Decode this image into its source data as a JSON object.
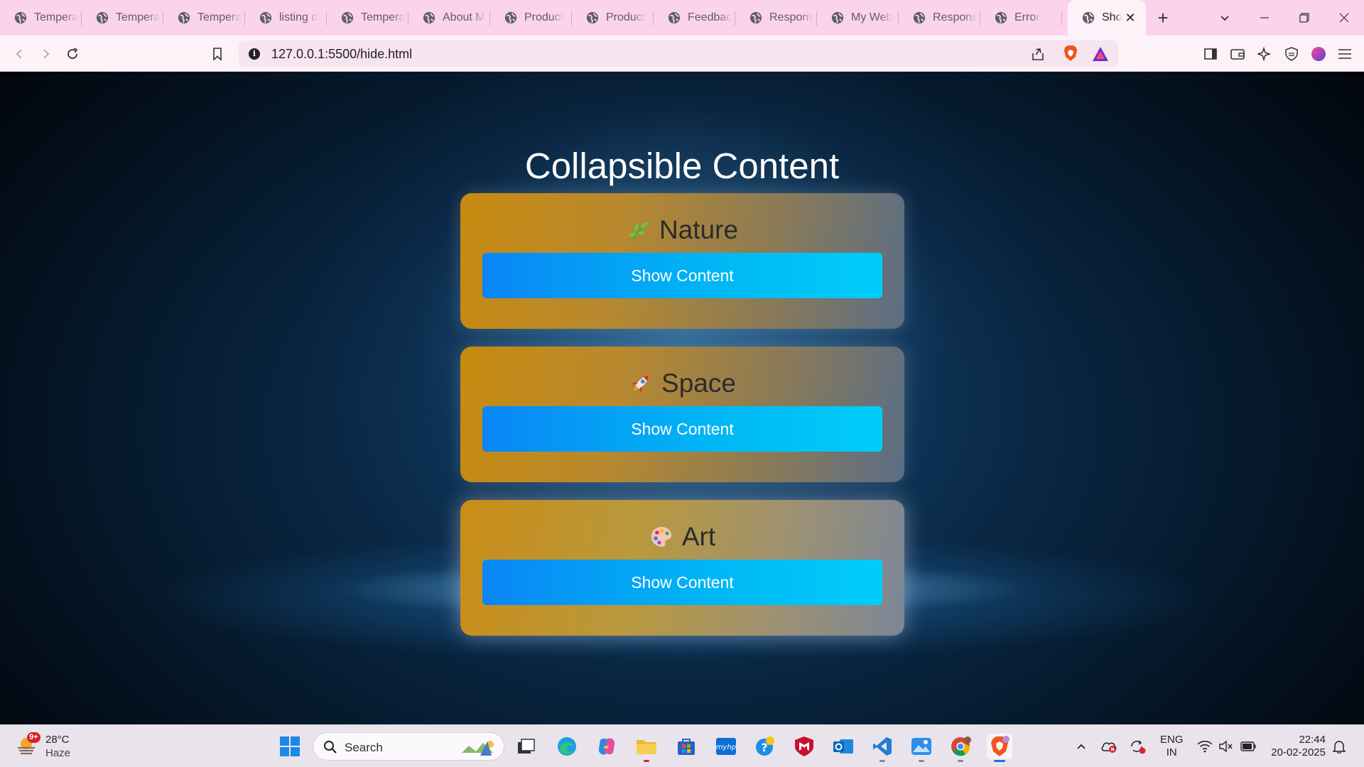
{
  "browser": {
    "tabs": [
      {
        "label": "Temperat"
      },
      {
        "label": "Temperat"
      },
      {
        "label": "Temperat"
      },
      {
        "label": "listing d"
      },
      {
        "label": "Temperat"
      },
      {
        "label": "About M"
      },
      {
        "label": "Product"
      },
      {
        "label": "Product"
      },
      {
        "label": "Feedbac"
      },
      {
        "label": "Respons"
      },
      {
        "label": "My Web"
      },
      {
        "label": "Respons"
      },
      {
        "label": "Error"
      }
    ],
    "active_tab": {
      "label": "Sho"
    },
    "url": "127.0.0.1:5500/hide.html"
  },
  "page": {
    "title": "Collapsible Content",
    "sections": [
      {
        "title": "Nature",
        "icon": "herb-icon",
        "button_label": "Show Content"
      },
      {
        "title": "Space",
        "icon": "rocket-icon",
        "button_label": "Show Content"
      },
      {
        "title": "Art",
        "icon": "palette-icon",
        "button_label": "Show Content"
      }
    ]
  },
  "taskbar": {
    "weather": {
      "temp": "28°C",
      "condition": "Haze",
      "badge": "9+"
    },
    "search_placeholder": "Search",
    "language": {
      "line1": "ENG",
      "line2": "IN"
    },
    "clock": {
      "time": "22:44",
      "date": "20-02-2025"
    }
  },
  "colors": {
    "tab_strip": "#fbd3ea",
    "card_gold": "#c88a10",
    "button_blue": "#0a86f5",
    "button_cyan": "#00cdfa"
  }
}
